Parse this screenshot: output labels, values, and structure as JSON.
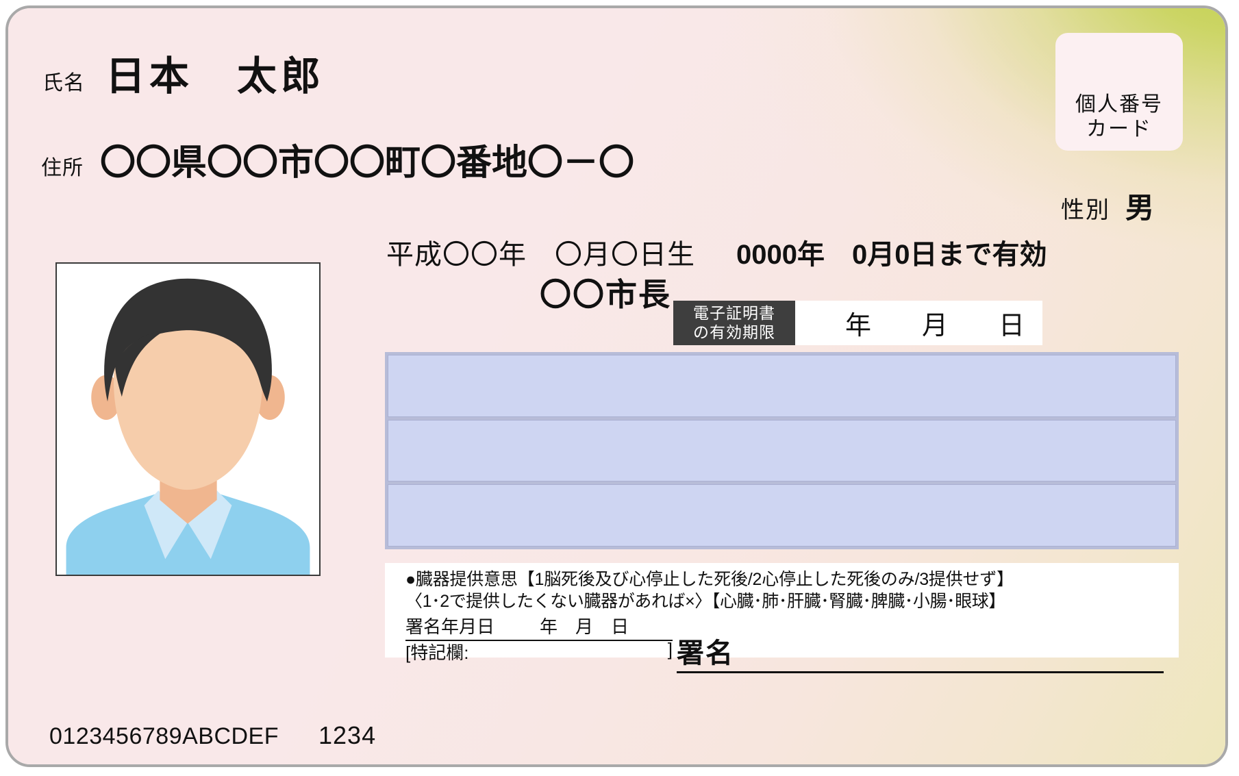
{
  "card": {
    "title_badge": {
      "line1": "個人番号",
      "line2": "カード"
    },
    "name": {
      "label": "氏名",
      "value": "日本　太郎"
    },
    "address": {
      "label": "住所",
      "value": "〇〇県〇〇市〇〇町〇番地〇－〇"
    },
    "gender": {
      "label": "性別",
      "value": "男"
    },
    "birth_date": "平成〇〇年　〇月〇日生",
    "expiry": "0000年　0月0日まで有効",
    "issuer": "〇〇市長",
    "certificate": {
      "tag_line1": "電子証明書",
      "tag_line2": "の有効期限",
      "unit_year": "年",
      "unit_month": "月",
      "unit_day": "日"
    },
    "organ_donation": {
      "line1": "●臓器提供意思【1脳死後及び心停止した死後/2心停止した死後のみ/3提供せず】",
      "line2": "〈1･2で提供したくない臓器があれば×〉【心臓･肺･肝臓･腎臓･脾臓･小腸･眼球】",
      "sign_date_label": "署名年月日",
      "sign_unit_year": "年",
      "sign_unit_month": "月",
      "sign_unit_day": "日",
      "remarks_open": "[特記欄:",
      "remarks_close": "]",
      "signature_label": "署名"
    },
    "footer": {
      "serial": "0123456789ABCDEF",
      "pin": "1234"
    },
    "photo": {
      "alt": "証明写真"
    },
    "colors": {
      "card_background": "#f9e8e9",
      "accent_green": "#bcce40",
      "card_border": "#a9a9a9",
      "blue_panel": "#ced5f2",
      "blue_panel_frame": "#b7bcd8",
      "cert_tag_background": "#3e3e3e",
      "hair": "#333333",
      "skin": "#f6cdab",
      "shirt": "#8ed0ee",
      "collar": "#cfe8f8"
    }
  }
}
